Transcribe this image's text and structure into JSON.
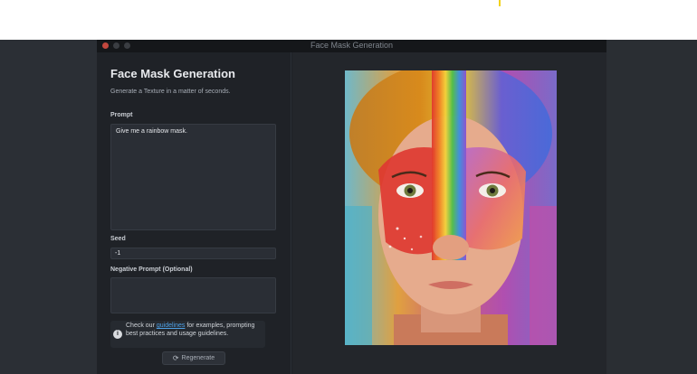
{
  "window": {
    "title": "Face Mask Generation"
  },
  "app": {
    "title": "Face Mask Generation",
    "subtitle": "Generate a Texture in a matter of seconds."
  },
  "prompt": {
    "label": "Prompt",
    "value": "Give me a rainbow mask."
  },
  "seed": {
    "label": "Seed",
    "value": "-1"
  },
  "negative_prompt": {
    "label": "Negative Prompt (Optional)",
    "value": ""
  },
  "info": {
    "text_before": "Check our ",
    "link_text": "guidelines",
    "text_after": " for examples, prompting best practices and usage guidelines."
  },
  "regenerate": {
    "label": "Regenerate",
    "icon": "refresh-icon"
  },
  "colors": {
    "accent_link": "#4ea1e6",
    "close_dot": "#c2473e",
    "panel_bg": "#1f2227"
  }
}
